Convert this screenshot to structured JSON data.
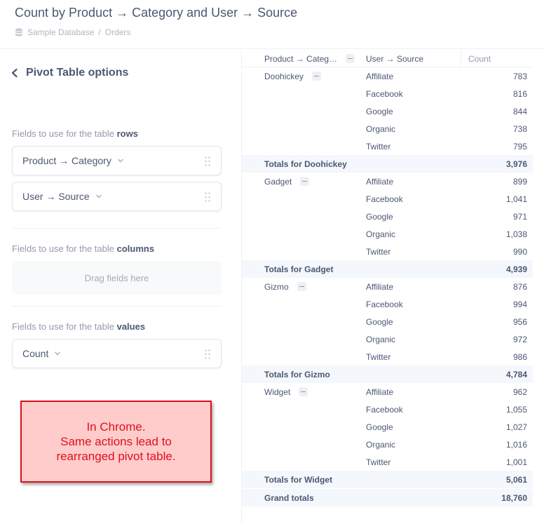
{
  "header": {
    "title": "Count by Product → Category and User → Source",
    "breadcrumb": [
      "Sample Database",
      "Orders"
    ],
    "breadcrumb_sep": "/"
  },
  "sidebar": {
    "back_label": "Pivot Table options",
    "rows_label_prefix": "Fields to use for the table ",
    "rows_label_strong": "rows",
    "row_fields": [
      "Product → Category",
      "User → Source"
    ],
    "columns_label_prefix": "Fields to use for the table ",
    "columns_label_strong": "columns",
    "columns_placeholder": "Drag fields here",
    "values_label_prefix": "Fields to use for the table ",
    "values_label_strong": "values",
    "value_fields": [
      "Count"
    ]
  },
  "note": {
    "line1": "In Chrome.",
    "line2": "Same actions lead to",
    "line3": "rearranged pivot table."
  },
  "table": {
    "headers": [
      "Product → Categ…",
      "User → Source",
      "Count"
    ],
    "groups": [
      {
        "category": "Doohickey",
        "rows": [
          {
            "source": "Affiliate",
            "count": "783"
          },
          {
            "source": "Facebook",
            "count": "816"
          },
          {
            "source": "Google",
            "count": "844"
          },
          {
            "source": "Organic",
            "count": "738"
          },
          {
            "source": "Twitter",
            "count": "795"
          }
        ],
        "total_label": "Totals for Doohickey",
        "total": "3,976"
      },
      {
        "category": "Gadget",
        "rows": [
          {
            "source": "Affiliate",
            "count": "899"
          },
          {
            "source": "Facebook",
            "count": "1,041"
          },
          {
            "source": "Google",
            "count": "971"
          },
          {
            "source": "Organic",
            "count": "1,038"
          },
          {
            "source": "Twitter",
            "count": "990"
          }
        ],
        "total_label": "Totals for Gadget",
        "total": "4,939"
      },
      {
        "category": "Gizmo",
        "rows": [
          {
            "source": "Affiliate",
            "count": "876"
          },
          {
            "source": "Facebook",
            "count": "994"
          },
          {
            "source": "Google",
            "count": "956"
          },
          {
            "source": "Organic",
            "count": "972"
          },
          {
            "source": "Twitter",
            "count": "986"
          }
        ],
        "total_label": "Totals for Gizmo",
        "total": "4,784"
      },
      {
        "category": "Widget",
        "rows": [
          {
            "source": "Affiliate",
            "count": "962"
          },
          {
            "source": "Facebook",
            "count": "1,055"
          },
          {
            "source": "Google",
            "count": "1,027"
          },
          {
            "source": "Organic",
            "count": "1,016"
          },
          {
            "source": "Twitter",
            "count": "1,001"
          }
        ],
        "total_label": "Totals for Widget",
        "total": "5,061"
      }
    ],
    "grand_total_label": "Grand totals",
    "grand_total": "18,760"
  },
  "colors": {
    "text": "#4c5773",
    "muted": "#949aab",
    "total_row_bg": "#f4f7fb",
    "note_bg": "#ffcccc",
    "note_border": "#d9121b"
  }
}
